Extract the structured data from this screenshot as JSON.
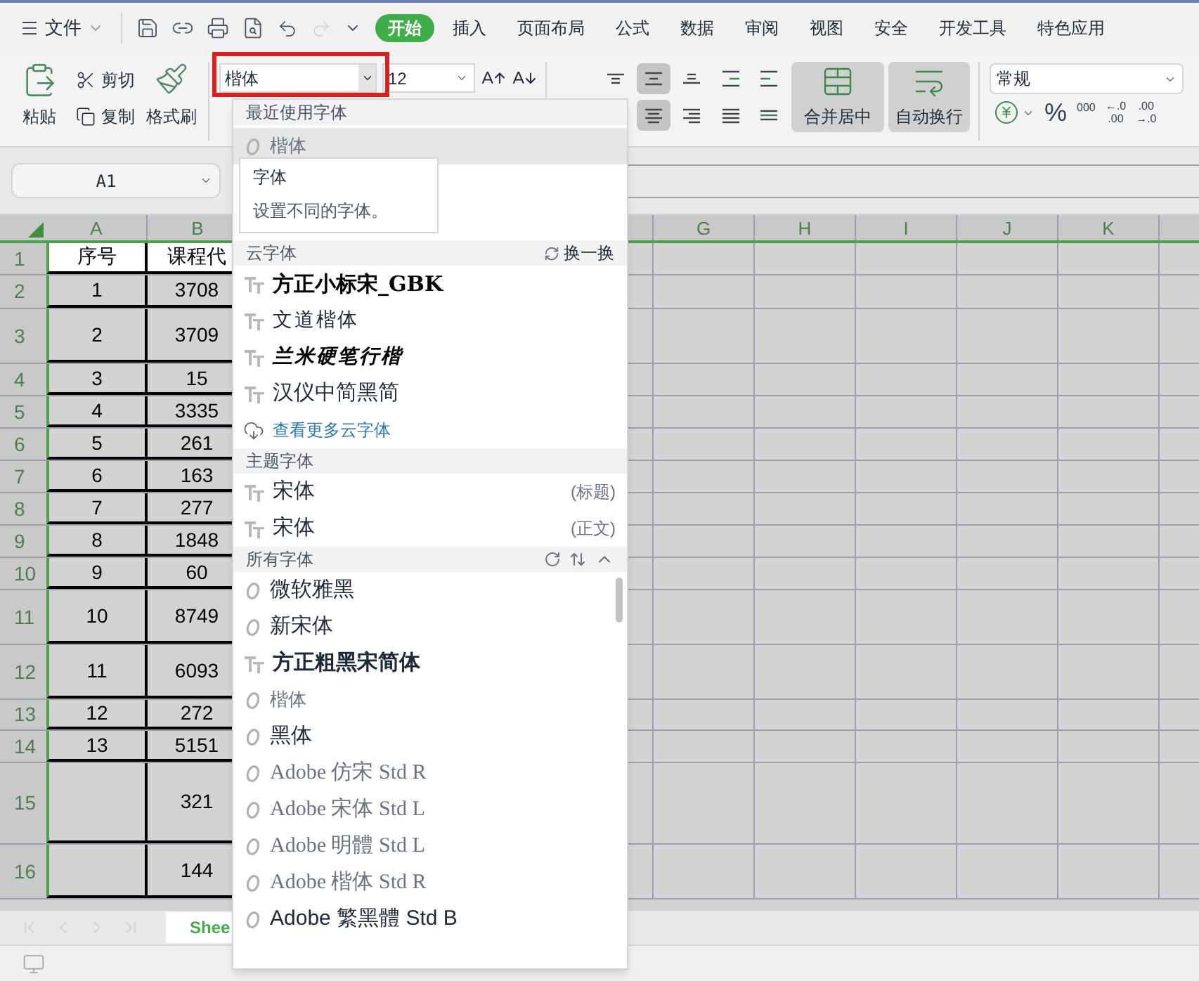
{
  "menu": {
    "file": "文件",
    "tabs": [
      {
        "label": "开始",
        "selected": true
      },
      {
        "label": "插入",
        "selected": false
      },
      {
        "label": "页面布局",
        "selected": false
      },
      {
        "label": "公式",
        "selected": false
      },
      {
        "label": "数据",
        "selected": false
      },
      {
        "label": "审阅",
        "selected": false
      },
      {
        "label": "视图",
        "selected": false
      },
      {
        "label": "安全",
        "selected": false
      },
      {
        "label": "开发工具",
        "selected": false
      },
      {
        "label": "特色应用",
        "selected": false
      }
    ]
  },
  "clipboard": {
    "paste": "粘贴",
    "cut": "剪切",
    "copy": "复制",
    "format_painter": "格式刷"
  },
  "font": {
    "name": "楷体",
    "size": "12",
    "highlighted": true
  },
  "align_buttons": [
    {
      "kind": "top",
      "selected": false
    },
    {
      "kind": "middle",
      "selected": true
    },
    {
      "kind": "bottom",
      "selected": false
    },
    {
      "kind": "indent-less",
      "selected": false
    },
    {
      "kind": "indent-more",
      "selected": false
    },
    {
      "kind": "center",
      "selected": true
    },
    {
      "kind": "right",
      "selected": false
    },
    {
      "kind": "justify",
      "selected": false
    },
    {
      "kind": "distributed",
      "selected": false
    }
  ],
  "merge": {
    "label": "合并居中",
    "selected": true
  },
  "wrap": {
    "label": "自动换行",
    "selected": true
  },
  "number": {
    "format": "常规",
    "percent": "%",
    "thousands": "000",
    "decimal_more": [
      "←.0",
      ".00"
    ],
    "decimal_less": [
      ".00",
      "→.0"
    ]
  },
  "name_box": "A1",
  "columns_left": [
    "A",
    "B"
  ],
  "columns_right": [
    "G",
    "H",
    "I",
    "J",
    "K"
  ],
  "rows": [
    {
      "number": "1",
      "cells": [
        "序号",
        "课程代"
      ],
      "selected": true
    },
    {
      "number": "2",
      "cells": [
        "1",
        "3708"
      ],
      "selected": false
    },
    {
      "number": "3",
      "cells": [
        "2",
        "3709"
      ],
      "selected": false
    },
    {
      "number": "4",
      "cells": [
        "3",
        "15"
      ],
      "selected": false
    },
    {
      "number": "5",
      "cells": [
        "4",
        "3335"
      ],
      "selected": false
    },
    {
      "number": "6",
      "cells": [
        "5",
        "261"
      ],
      "selected": false
    },
    {
      "number": "7",
      "cells": [
        "6",
        "163"
      ],
      "selected": false
    },
    {
      "number": "8",
      "cells": [
        "7",
        "277"
      ],
      "selected": false
    },
    {
      "number": "9",
      "cells": [
        "8",
        "1848"
      ],
      "selected": false
    },
    {
      "number": "10",
      "cells": [
        "9",
        "60"
      ],
      "selected": false
    },
    {
      "number": "11",
      "cells": [
        "10",
        "8749"
      ],
      "selected": false
    },
    {
      "number": "12",
      "cells": [
        "11",
        "6093"
      ],
      "selected": false
    },
    {
      "number": "13",
      "cells": [
        "12",
        "272"
      ],
      "selected": false
    },
    {
      "number": "14",
      "cells": [
        "13",
        "5151"
      ],
      "selected": false
    },
    {
      "number": "15",
      "cells": [
        "",
        "321"
      ],
      "selected": false
    },
    {
      "number": "16",
      "cells": [
        "",
        "144"
      ],
      "selected": false
    }
  ],
  "sheet_tab": "Shee",
  "dropdown": {
    "recent_title": "最近使用字体",
    "recent": [
      {
        "name": "楷体",
        "kind": "system"
      }
    ],
    "tooltip": {
      "title": "字体",
      "text": "设置不同的字体。"
    },
    "cloud_title": "云字体",
    "cloud_action": "换一换",
    "cloud": [
      {
        "name": "方正小标宋_GBK",
        "kind": "cloud"
      },
      {
        "name": "文道楷体",
        "kind": "cloud"
      },
      {
        "name": "兰米硬笔行楷",
        "kind": "cloud"
      },
      {
        "name": "汉仪中简黑简",
        "kind": "cloud"
      }
    ],
    "more_link": "查看更多云字体",
    "theme_title": "主题字体",
    "theme": [
      {
        "name": "宋体",
        "kind": "cloud",
        "tag": "(标题)"
      },
      {
        "name": "宋体",
        "kind": "cloud",
        "tag": "(正文)"
      }
    ],
    "all_title": "所有字体",
    "all": [
      {
        "name": "微软雅黑",
        "kind": "system"
      },
      {
        "name": "新宋体",
        "kind": "system"
      },
      {
        "name": "方正粗黑宋简体",
        "kind": "cloud"
      },
      {
        "name": "楷体",
        "kind": "system"
      },
      {
        "name": "黑体",
        "kind": "system"
      },
      {
        "name": "Adobe 仿宋 Std R",
        "kind": "system"
      },
      {
        "name": "Adobe 宋体 Std L",
        "kind": "system"
      },
      {
        "name": "Adobe 明體 Std L",
        "kind": "system"
      },
      {
        "name": "Adobe 楷体 Std R",
        "kind": "system"
      },
      {
        "name": "Adobe 繁黑體 Std B",
        "kind": "system"
      }
    ]
  }
}
